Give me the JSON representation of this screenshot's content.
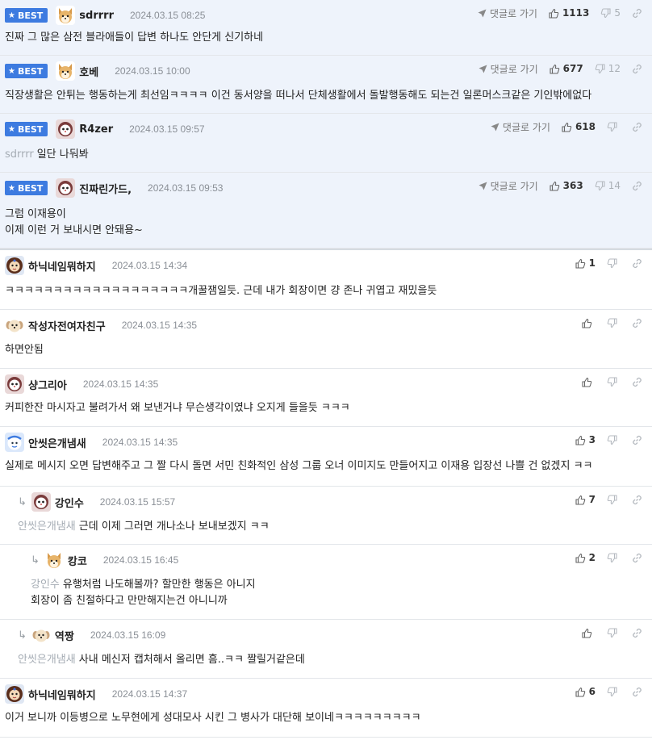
{
  "labels": {
    "best": "BEST",
    "reply": "댓글로 가기"
  },
  "colors": {
    "best_bg": "#eef3fb",
    "badge": "#3d7be0",
    "meta": "#8a8f96"
  },
  "comments": [
    {
      "best": true,
      "avatar": "shiba-icon",
      "nick": "sdrrrr",
      "date": "2024.03.15 08:25",
      "up": "1113",
      "down": "5",
      "lines": [
        "진짜 그 많은 삼전 블라애들이 답변 하나도 안단게 신기하네"
      ]
    },
    {
      "best": true,
      "avatar": "shiba-icon",
      "nick": "호베",
      "date": "2024.03.15 10:00",
      "up": "677",
      "down": "12",
      "lines": [
        "직장생활은 안튀는 행동하는게 최선임ㅋㅋㅋㅋ 이건 동서양을 떠나서 단체생활에서 돌발행동해도 되는건 일론머스크같은 기인밖에없다"
      ]
    },
    {
      "best": true,
      "avatar": "cat-icon",
      "nick": "R4zer",
      "date": "2024.03.15 09:57",
      "up": "618",
      "down": "",
      "target": "sdrrrr",
      "lines": [
        "일단 나둬봐"
      ]
    },
    {
      "best": true,
      "avatar": "cat-icon",
      "nick": "진짜린가드,",
      "date": "2024.03.15 09:53",
      "up": "363",
      "down": "14",
      "lines": [
        "그럼 이재용이",
        "이제 이런 거 보내시면 안돼용~"
      ]
    },
    {
      "best": false,
      "avatar": "lion-icon",
      "nick": "하닉네임뭐하지",
      "date": "2024.03.15 14:34",
      "up": "1",
      "down": "",
      "lines": [
        "ㅋㅋㅋㅋㅋㅋㅋㅋㅋㅋㅋㅋㅋㅋㅋㅋㅋㅋㅋ개꿀잼일듯. 근데 내가 회장이면 걍 존나 귀엽고 재밌을듯"
      ]
    },
    {
      "best": false,
      "avatar": "puppy-icon",
      "nick": "작성자전여자친구",
      "date": "2024.03.15 14:35",
      "up": "",
      "down": "",
      "lines": [
        "하면안됨"
      ]
    },
    {
      "best": false,
      "avatar": "cat-icon",
      "nick": "샹그리아",
      "date": "2024.03.15 14:35",
      "up": "",
      "down": "",
      "lines": [
        "커피한잔 마시자고 불려가서 왜 보낸거냐 무슨생각이였냐 오지게 들을듯 ㅋㅋㅋ"
      ]
    },
    {
      "best": false,
      "avatar": "blue-icon",
      "nick": "안씻은개냄새",
      "date": "2024.03.15 14:35",
      "up": "3",
      "down": "",
      "lines": [
        "실제로 메시지 오면 답변해주고 그 짤 다시 돌면 서민 친화적인 삼성 그룹 오너 이미지도 만들어지고 이재용 입장선 나쁠 건 없겠지 ㅋㅋ"
      ]
    },
    {
      "best": false,
      "avatar": "cat-icon",
      "nick": "강인수",
      "date": "2024.03.15 15:57",
      "up": "7",
      "down": "",
      "target": "안씻은개냄새",
      "lines": [
        "근데 이제 그러면 개나소나 보내보겠지 ㅋㅋ"
      ]
    },
    {
      "best": false,
      "avatar": "shiba-icon",
      "nick": "캉코",
      "date": "2024.03.15 16:45",
      "up": "2",
      "down": "",
      "target": "강인수",
      "lines": [
        "유행처럼 나도해볼까? 할만한 행동은 아니지",
        "회장이 좀 친절하다고 만만해지는건 아니니까"
      ]
    },
    {
      "best": false,
      "avatar": "puppy-icon",
      "nick": "역짱",
      "date": "2024.03.15 16:09",
      "up": "",
      "down": "",
      "target": "안씻은개냄새",
      "lines": [
        "사내 메신저 캡처해서 올리면 흠..ㅋㅋ 짤릴거같은데"
      ]
    },
    {
      "best": false,
      "avatar": "lion-icon",
      "nick": "하닉네임뭐하지",
      "date": "2024.03.15 14:37",
      "up": "6",
      "down": "",
      "lines": [
        "이거 보니까 이등병으로 노무현에게 성대모사 시킨 그 병사가 대단해 보이네ㅋㅋㅋㅋㅋㅋㅋㅋㅋ"
      ]
    }
  ]
}
